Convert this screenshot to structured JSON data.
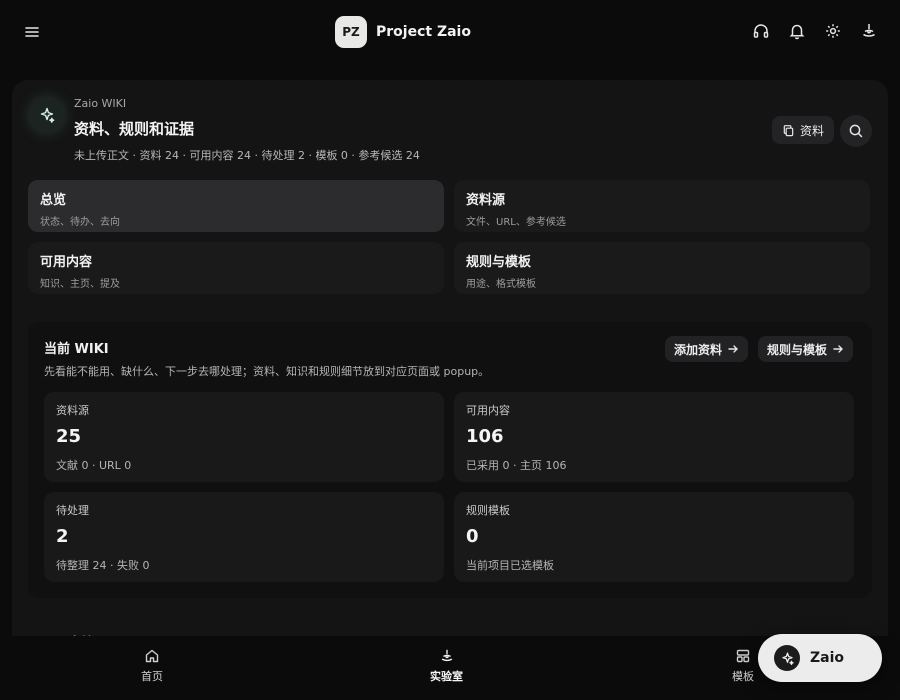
{
  "header": {
    "avatar_initials": "PZ",
    "project_name": "Project Zaio",
    "icons": [
      "menu-icon",
      "headphones-icon",
      "bell-icon",
      "gear-icon",
      "lab-icon"
    ]
  },
  "wiki": {
    "kicker": "Zaio WIKI",
    "title": "资料、规则和证据",
    "meta": "未上传正文 · 资料 24 · 可用内容 24 · 待处理 2 · 模板 0 · 参考候选 24",
    "docs_button": "资料"
  },
  "nav_cards": [
    {
      "title": "总览",
      "subtitle": "状态、待办、去向",
      "active": true
    },
    {
      "title": "资料源",
      "subtitle": "文件、URL、参考候选",
      "active": false
    },
    {
      "title": "可用内容",
      "subtitle": "知识、主页、提及",
      "active": false
    },
    {
      "title": "规则与模板",
      "subtitle": "用途、格式模板",
      "active": false
    }
  ],
  "current": {
    "title": "当前 WIKI",
    "description": "先看能不能用、缺什么、下一步去哪处理；资料、知识和规则细节放到对应页面或 popup。",
    "add_button": "添加资料",
    "rules_button": "规则与模板",
    "stats": [
      {
        "label": "资料源",
        "value": "25",
        "sub": "文献 0 · URL 0"
      },
      {
        "label": "可用内容",
        "value": "106",
        "sub": "已采用 0 · 主页 106"
      },
      {
        "label": "待处理",
        "value": "2",
        "sub": "待整理 24 · 失败 0"
      },
      {
        "label": "规则模板",
        "value": "0",
        "sub": "当前项目已选模板"
      }
    ]
  },
  "peek_section_title": "下一步处理",
  "bottom_nav": [
    {
      "label": "首页",
      "icon": "home-icon",
      "active": false
    },
    {
      "label": "实验室",
      "icon": "lab-icon",
      "active": true
    },
    {
      "label": "模板",
      "icon": "template-icon",
      "active": false
    }
  ],
  "fab": {
    "label": "Zaio",
    "icon": "sparkle-icon"
  }
}
